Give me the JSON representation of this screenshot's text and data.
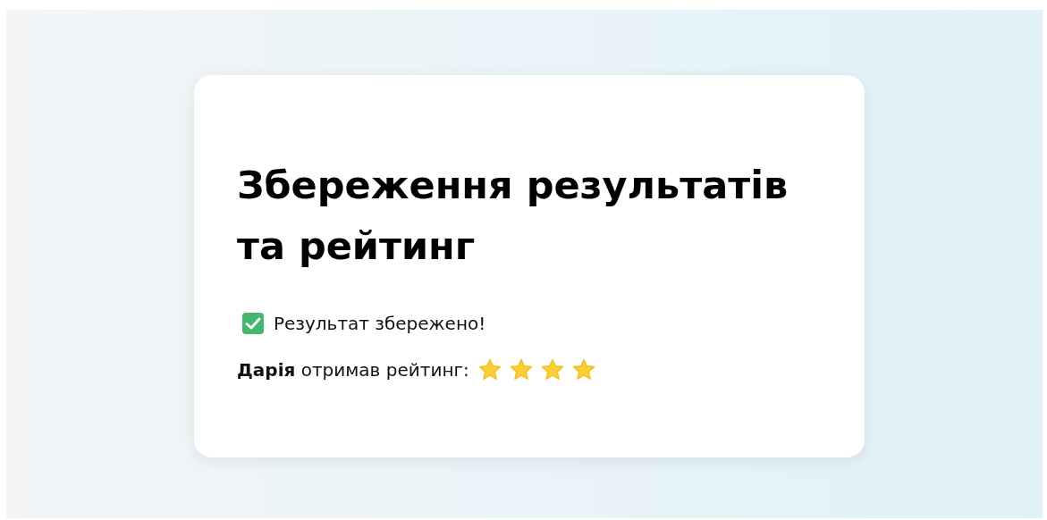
{
  "card": {
    "title": "Збереження результатів та рейтинг",
    "status": "Результат збережено!",
    "rating_text": "**Дарія** отримав рейтинг:",
    "rating": {
      "stars": 4
    }
  }
}
